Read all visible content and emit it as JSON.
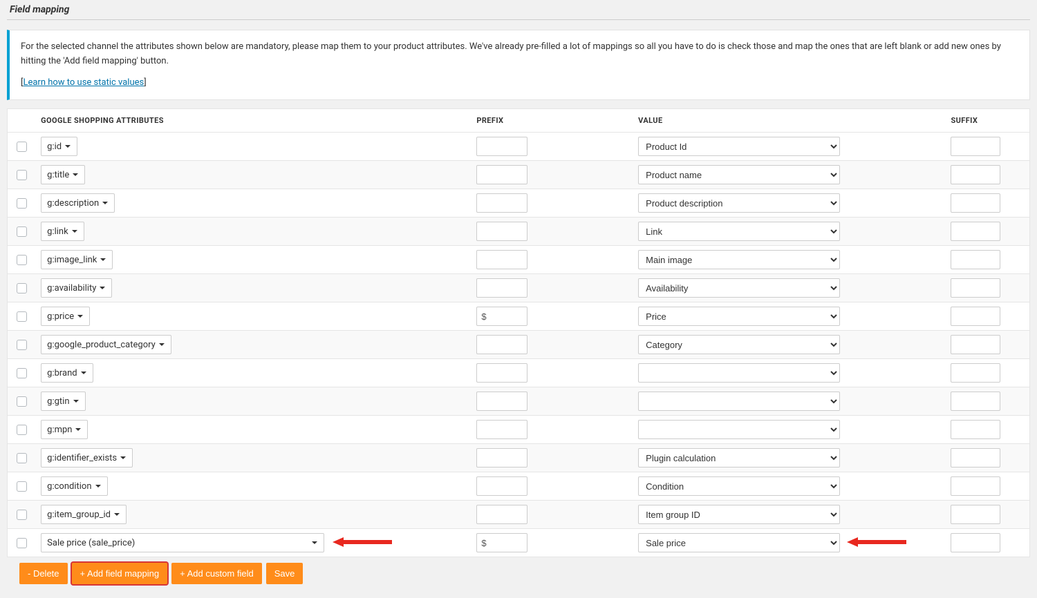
{
  "section_title": "Field mapping",
  "notice": {
    "body": "For the selected channel the attributes shown below are mandatory, please map them to your product attributes. We've already pre-filled a lot of mappings so all you have to do is check those and map the ones that are left blank or add new ones by hitting the 'Add field mapping' button.",
    "link_label": "Learn how to use static values"
  },
  "headers": {
    "attr": "Google Shopping attributes",
    "prefix": "Prefix",
    "value": "Value",
    "suffix": "Suffix"
  },
  "rows": [
    {
      "attr": "g:id",
      "full": false,
      "prefix": "",
      "value": "Product Id",
      "suffix": ""
    },
    {
      "attr": "g:title",
      "full": false,
      "prefix": "",
      "value": "Product name",
      "suffix": ""
    },
    {
      "attr": "g:description",
      "full": false,
      "prefix": "",
      "value": "Product description",
      "suffix": ""
    },
    {
      "attr": "g:link",
      "full": false,
      "prefix": "",
      "value": "Link",
      "suffix": ""
    },
    {
      "attr": "g:image_link",
      "full": false,
      "prefix": "",
      "value": "Main image",
      "suffix": ""
    },
    {
      "attr": "g:availability",
      "full": false,
      "prefix": "",
      "value": "Availability",
      "suffix": ""
    },
    {
      "attr": "g:price",
      "full": false,
      "prefix": "$",
      "value": "Price",
      "suffix": ""
    },
    {
      "attr": "g:google_product_category",
      "full": false,
      "prefix": "",
      "value": "Category",
      "suffix": ""
    },
    {
      "attr": "g:brand",
      "full": false,
      "prefix": "",
      "value": "",
      "suffix": ""
    },
    {
      "attr": "g:gtin",
      "full": false,
      "prefix": "",
      "value": "",
      "suffix": ""
    },
    {
      "attr": "g:mpn",
      "full": false,
      "prefix": "",
      "value": "",
      "suffix": ""
    },
    {
      "attr": "g:identifier_exists",
      "full": false,
      "prefix": "",
      "value": "Plugin calculation",
      "suffix": ""
    },
    {
      "attr": "g:condition",
      "full": false,
      "prefix": "",
      "value": "Condition",
      "suffix": ""
    },
    {
      "attr": "g:item_group_id",
      "full": false,
      "prefix": "",
      "value": "Item group ID",
      "suffix": ""
    },
    {
      "attr": "Sale price (sale_price)",
      "full": true,
      "prefix": "$",
      "value": "Sale price",
      "suffix": "",
      "arrow_attr": true,
      "arrow_value": true
    }
  ],
  "buttons": {
    "delete": "- Delete",
    "add_mapping": "+ Add field mapping",
    "add_custom": "+ Add custom field",
    "save": "Save"
  }
}
